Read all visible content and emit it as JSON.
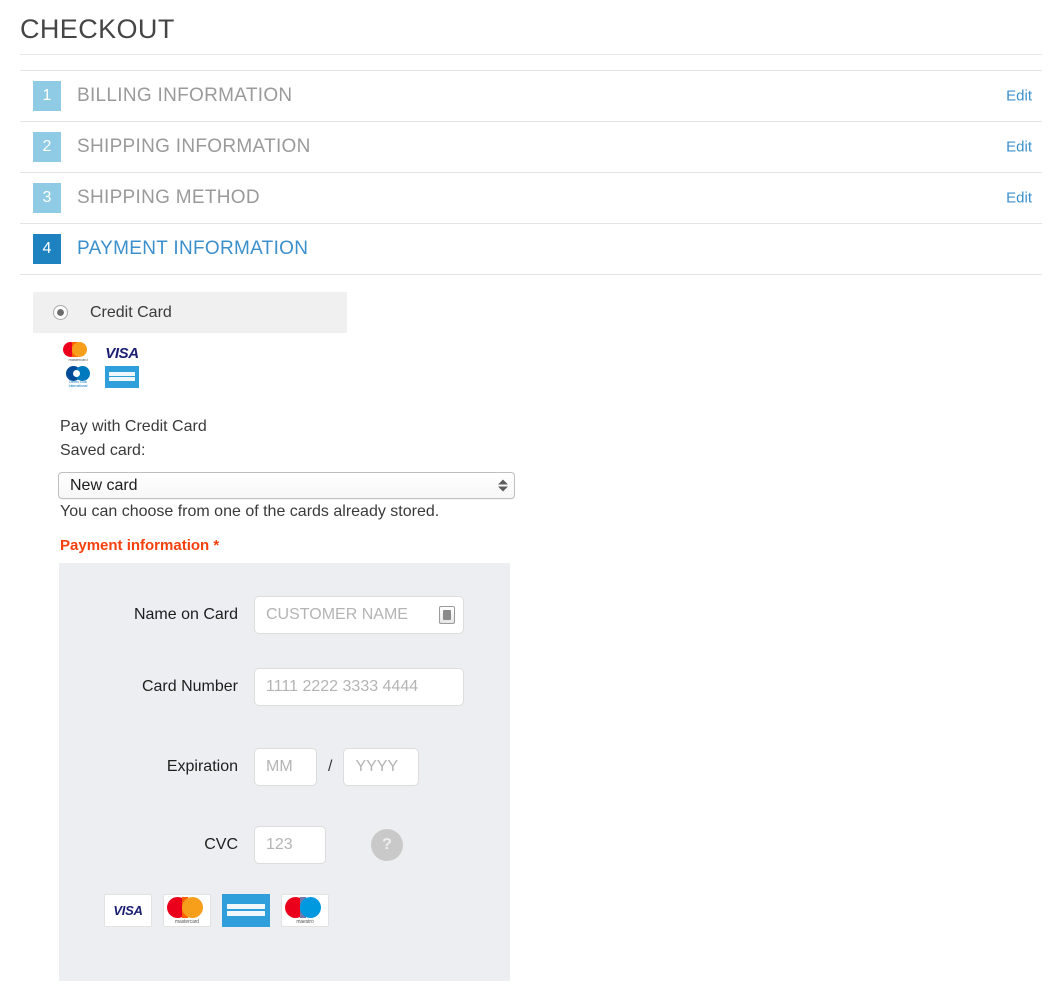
{
  "page": {
    "title": "CHECKOUT"
  },
  "steps": [
    {
      "number": "1",
      "title": "BILLING INFORMATION",
      "edit_label": "Edit",
      "active": false,
      "has_edit": true
    },
    {
      "number": "2",
      "title": "SHIPPING INFORMATION",
      "edit_label": "Edit",
      "active": false,
      "has_edit": true
    },
    {
      "number": "3",
      "title": "SHIPPING METHOD",
      "edit_label": "Edit",
      "active": false,
      "has_edit": true
    },
    {
      "number": "4",
      "title": "PAYMENT INFORMATION",
      "edit_label": "",
      "active": true,
      "has_edit": false
    }
  ],
  "payment": {
    "method_label": "Credit Card",
    "method_selected": true,
    "accepted_brands_top": [
      "mastercard",
      "visa",
      "diners-club",
      "american-express"
    ],
    "pay_with_heading": "Pay with Credit Card",
    "saved_card_label": "Saved card:",
    "saved_card_value": "New card",
    "saved_card_options": [
      "New card"
    ],
    "saved_card_hint": "You can choose from one of the cards already stored.",
    "required_section_label": "Payment information",
    "required_marker": "*",
    "fields": {
      "name_on_card": {
        "label": "Name on Card",
        "value": "",
        "placeholder": "CUSTOMER NAME"
      },
      "card_number": {
        "label": "Card Number",
        "value": "",
        "placeholder": "1111 2222 3333 4444"
      },
      "expiration": {
        "label": "Expiration",
        "separator": "/",
        "month": {
          "value": "",
          "placeholder": "MM"
        },
        "year": {
          "value": "",
          "placeholder": "YYYY"
        }
      },
      "cvc": {
        "label": "CVC",
        "value": "",
        "placeholder": "123",
        "help_glyph": "?"
      }
    },
    "accepted_brands_bottom": [
      "visa",
      "mastercard",
      "american-express",
      "maestro"
    ],
    "brand_names": {
      "visa": "VISA",
      "mastercard": "mastercard",
      "maestro": "maestro",
      "amex_line1": "AMERICAN",
      "amex_line2": "EXPRESS",
      "diners_line1": "Diners Club",
      "diners_line2": "International"
    }
  },
  "colors": {
    "accent_blue": "#3b90cc",
    "step_badge_inactive": "#8fcbe4",
    "step_badge_active": "#1f82c0",
    "required_red": "#f4400d",
    "panel_gray": "#edeef2",
    "method_bar_gray": "#f0f0f0"
  }
}
